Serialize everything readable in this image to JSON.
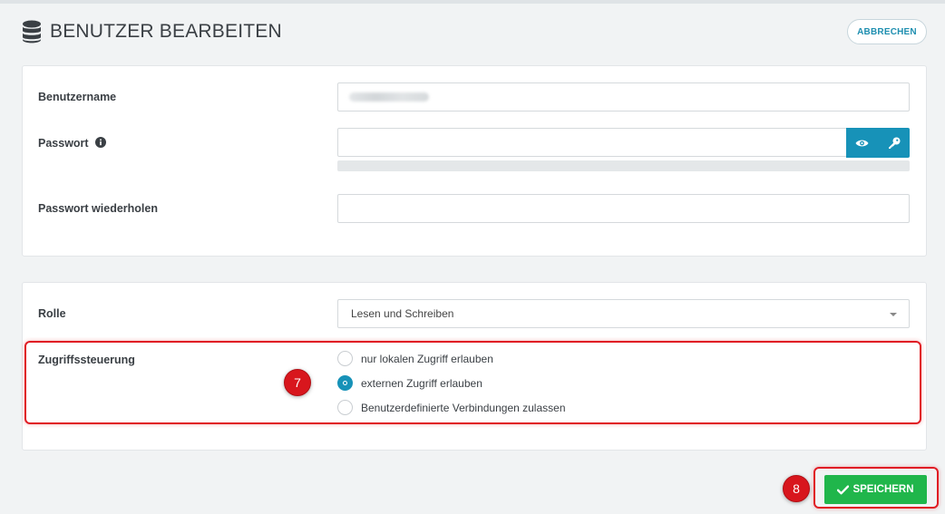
{
  "header": {
    "title": "BENUTZER BEARBEITEN",
    "cancel_label": "ABBRECHEN",
    "title_icon": "database-icon"
  },
  "account": {
    "username_label": "Benutzername",
    "password_label": "Passwort",
    "password_info_icon": "info-icon",
    "password_repeat_label": "Passwort wiederholen",
    "password_value": "",
    "password_repeat_value": "",
    "show_password_icon": "eye-icon",
    "generate_password_icon": "key-icon"
  },
  "access": {
    "role_label": "Rolle",
    "role_selected": "Lesen und Schreiben",
    "access_label": "Zugriffssteuerung",
    "options": [
      {
        "label": "nur lokalen Zugriff erlauben",
        "checked": false
      },
      {
        "label": "externen Zugriff erlauben",
        "checked": true
      },
      {
        "label": "Benutzerdefinierte Verbindungen zulassen",
        "checked": false
      }
    ]
  },
  "annotations": {
    "marker_1": "7",
    "marker_2": "8"
  },
  "footer": {
    "save_label": "SPEICHERN",
    "save_icon": "check-icon"
  },
  "colors": {
    "accent": "#1792b8",
    "save_green": "#20b64b",
    "highlight_red": "#e01c24",
    "background": "#f1f3f4"
  }
}
